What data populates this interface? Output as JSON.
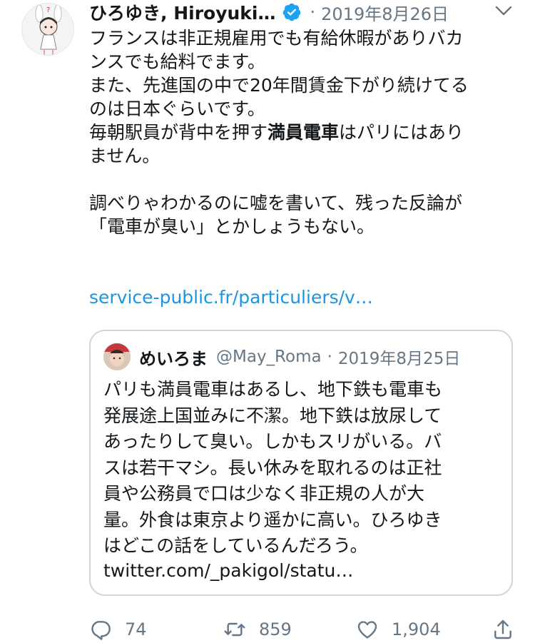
{
  "tweet": {
    "display_name": "ひろゆき, Hiroyuki…",
    "separator": "·",
    "date": "2019年8月26日",
    "text_lines": [
      "フランスは非正規雇用でも有給休暇がありバカ",
      "ンスでも給料でます。",
      "また、先進国の中で20年間賃金下がり続けてる",
      "のは日本ぐらいです。"
    ],
    "line5_before": "毎朝駅員が背中を押す",
    "line5_bold": "満員電車",
    "line5_after": "はパリにはあり",
    "text_lines_after": [
      "ません。",
      "",
      "調べりゃわかるのに嘘を書いて、残った反論が",
      "「電車が臭い」とかしょうもない。"
    ],
    "link": "service-public.fr/particuliers/v…"
  },
  "quote": {
    "display_name": "めいろま",
    "handle": "@May_Roma",
    "separator": "·",
    "date": "2019年8月25日",
    "text": "パリも満員電車はあるし、地下鉄も電車も\n発展途上国並みに不潔。地下鉄は放尿して\nあったりして臭い。しかもスリがいる。バ\nスは若干マシ。長い休みを取れるのは正社\n員や公務員で口は少なく非正規の人が大\n量。外食は東京より遥かに高い。ひろゆき\nはどこの話をしているんだろう。",
    "link": "twitter.com/_pakigol/statu…"
  },
  "actions": {
    "reply_count": "74",
    "retweet_count": "859",
    "like_count": "1,904"
  },
  "colors": {
    "link": "#1b95e0",
    "secondary_text": "#657786",
    "verified": "#1da1f2",
    "border": "#ccd6dd"
  },
  "icons": {
    "verified": "verified-badge-icon",
    "caret": "chevron-down-icon",
    "reply": "reply-icon",
    "retweet": "retweet-icon",
    "like": "heart-icon",
    "share": "share-icon"
  }
}
